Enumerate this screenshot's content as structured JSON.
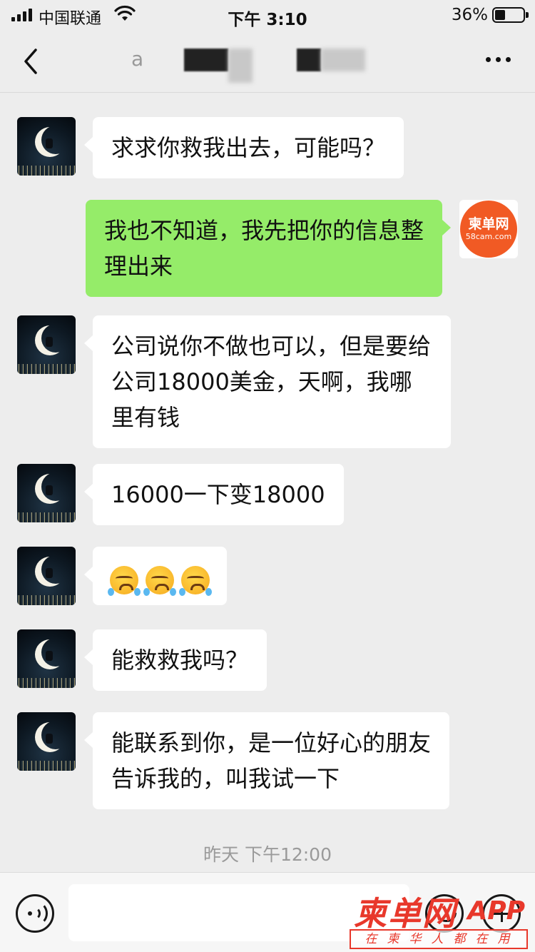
{
  "status_bar": {
    "carrier": "中国联通",
    "time": "下午 3:10",
    "battery_percent": "36%"
  },
  "nav": {
    "title": "a"
  },
  "messages": [
    {
      "side": "in",
      "text": "求求你救我出去，可能吗？"
    },
    {
      "side": "out",
      "text": "我也不知道，我先把你的信息整理出来"
    },
    {
      "side": "in",
      "text": "公司说你不做也可以，但是要给公司18000美金，天啊，我哪里有钱"
    },
    {
      "side": "in",
      "text": "16000一下变18000"
    },
    {
      "side": "in",
      "text": "",
      "emoji": "crying-angry-emoji x3"
    },
    {
      "side": "in",
      "text": "能救救我吗？"
    },
    {
      "side": "in",
      "text": "能联系到你，是一位好心的朋友告诉我的，叫我试一下"
    }
  ],
  "timestamp": "昨天 下午12:00",
  "self_avatar": {
    "logo_line1": "柬单网",
    "logo_line2": "58cam.com",
    "brand_color": "#f15a24"
  },
  "input": {
    "value": "",
    "placeholder": ""
  },
  "watermark": {
    "brand": "柬单网",
    "app": "APP",
    "slogan": "在柬华人都在用"
  },
  "colors": {
    "background": "#ededed",
    "incoming_bubble": "#ffffff",
    "outgoing_bubble": "#95ec69",
    "watermark_red": "#e8382b"
  },
  "icons": [
    "signal-icon",
    "wifi-icon",
    "battery-icon",
    "back-icon",
    "more-icon",
    "voice-icon",
    "emoji-icon",
    "plus-icon"
  ]
}
